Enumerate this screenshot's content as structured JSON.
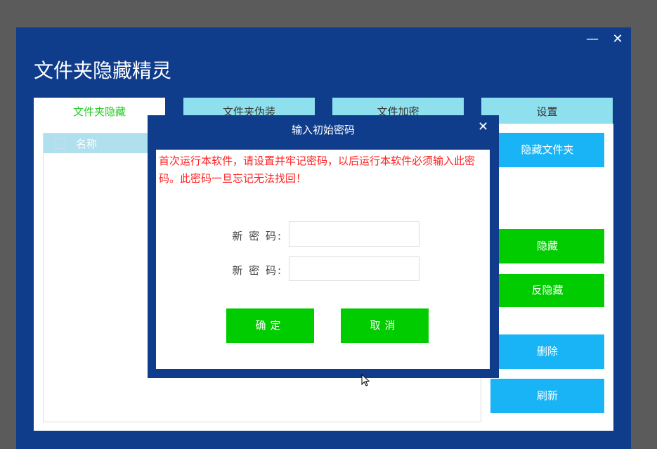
{
  "window": {
    "title": "文件夹隐藏精灵",
    "minimize": "—",
    "close": "✕"
  },
  "tabs": [
    {
      "label": "文件夹隐藏"
    },
    {
      "label": "文件夹伪装"
    },
    {
      "label": "文件加密"
    },
    {
      "label": "设置"
    }
  ],
  "list": {
    "column_name": "名称"
  },
  "actions": {
    "hide_folder": "隐藏文件夹",
    "hide": "隐藏",
    "unhide": "反隐藏",
    "delete": "删除",
    "refresh": "刷新"
  },
  "dialog": {
    "title": "输入初始密码",
    "close": "✕",
    "message": "首次运行本软件，请设置并牢记密码，以后运行本软件必须输入此密码。此密码一旦忘记无法找回！",
    "label1": "新 密 码:",
    "label2": "新 密 码:",
    "value1": "",
    "value2": "",
    "ok": "确定",
    "cancel": "取消"
  }
}
